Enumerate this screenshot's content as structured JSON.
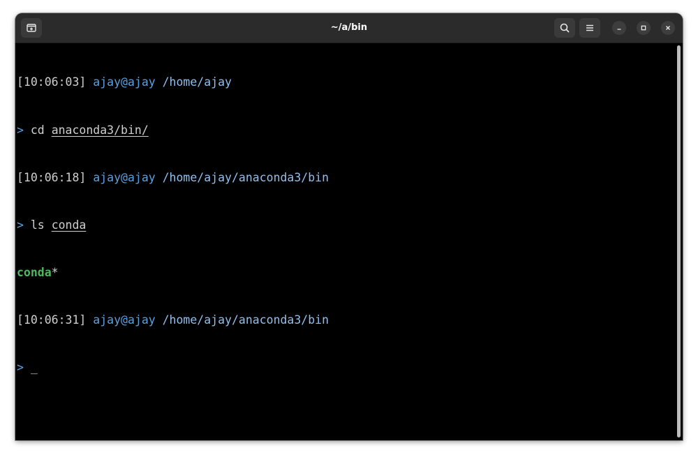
{
  "window": {
    "title": "~/a/bin"
  },
  "icons": {
    "new_tab": "new-tab-icon",
    "search": "search-icon",
    "menu": "hamburger-menu-icon",
    "minimize": "minimize-icon",
    "maximize": "maximize-icon",
    "close": "close-icon"
  },
  "terminal": {
    "lines": [
      {
        "ts": "[10:06:03]",
        "user": "ajay@ajay",
        "path": "/home/ajay"
      },
      {
        "prompt": ">",
        "cmd": "cd",
        "arg": "anaconda3/bin/"
      },
      {
        "ts": "[10:06:18]",
        "user": "ajay@ajay",
        "path": "/home/ajay/anaconda3/bin"
      },
      {
        "prompt": ">",
        "cmd": "ls",
        "arg": "conda"
      },
      {
        "exe": "conda",
        "mark": "*"
      },
      {
        "ts": "[10:06:31]",
        "user": "ajay@ajay",
        "path": "/home/ajay/anaconda3/bin"
      },
      {
        "prompt": ">",
        "cursor": "_"
      }
    ]
  },
  "colors": {
    "background": "#000000",
    "titlebar": "#2b2b2b",
    "user": "#5aa0e0",
    "path": "#8fbfee",
    "executable": "#4fb85c",
    "text": "#cfcfcf"
  }
}
